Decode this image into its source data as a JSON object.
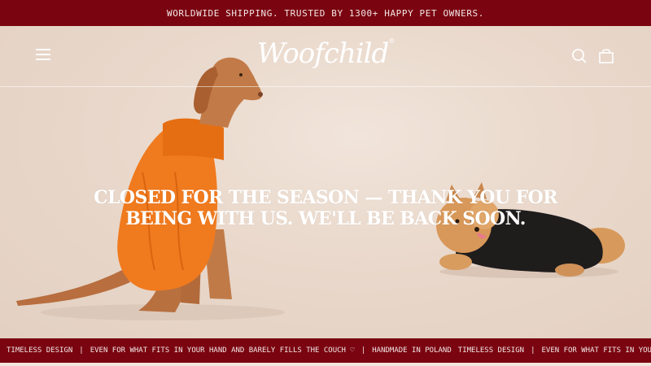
{
  "announcement": "WORLDWIDE SHIPPING. TRUSTED BY 1300+ HAPPY PET OWNERS.",
  "header": {
    "logo": "Woofchild",
    "logo_mark": "®",
    "menu_icon": "hamburger-menu-icon",
    "search_icon": "search-icon",
    "cart_icon": "shopping-bag-icon"
  },
  "hero": {
    "headline_line1": "CLOSED FOR THE SEASON — THANK YOU FOR",
    "headline_line2": "BEING WITH US. WE'LL BE BACK SOON."
  },
  "ticker": {
    "items": [
      "TIMELESS DESIGN",
      "|",
      "EVEN FOR WHAT FITS IN YOUR HAND AND BARELY FILLS THE COUCH ♡",
      "|",
      "HANDMADE IN POLAND",
      "TIMELESS DESIGN",
      "|",
      "EVEN FOR WHAT FITS IN YOUR HAND AND BARELY FILLS THE COUCH ♡"
    ]
  },
  "colors": {
    "brand_maroon": "#7a0510",
    "hero_bg": "#eadbd0",
    "sweater_orange": "#f07a1e",
    "sweater_black": "#1f1c1c"
  }
}
